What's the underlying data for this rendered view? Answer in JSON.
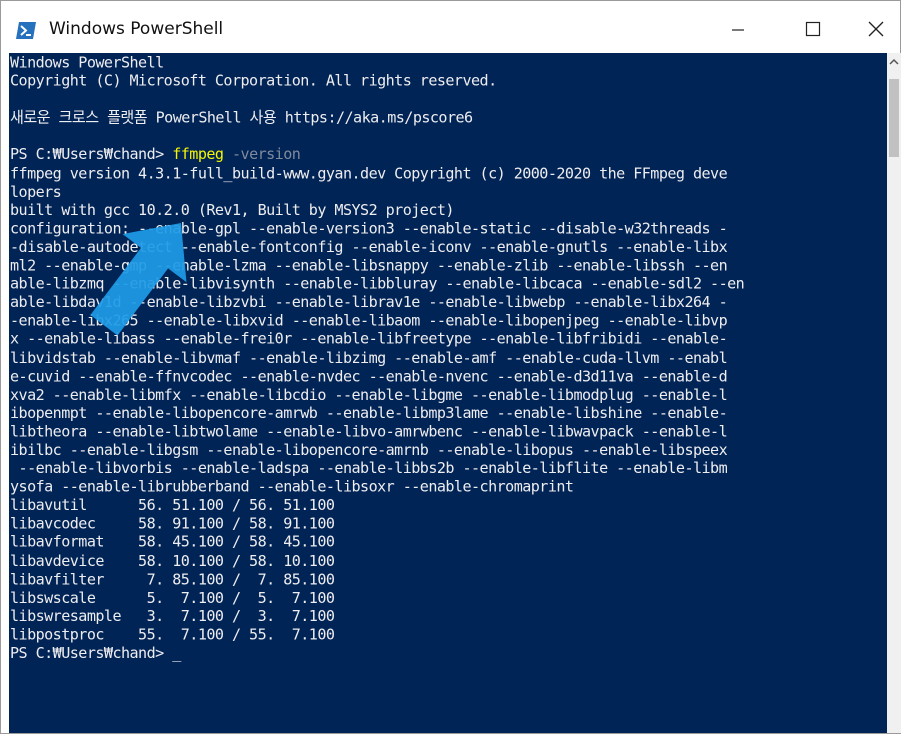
{
  "window": {
    "title": "Windows PowerShell",
    "icon": "powershell-icon",
    "controls": [
      "minimize-icon",
      "maximize-icon",
      "close-icon"
    ]
  },
  "console": {
    "lines": [
      "Windows PowerShell",
      "Copyright (C) Microsoft Corporation. All rights reserved.",
      "",
      "새로운 크로스 플랫폼 PowerShell 사용 https://aka.ms/pscore6",
      "",
      "",
      "ffmpeg version 4.3.1-full_build-www.gyan.dev Copyright (c) 2000-2020 the FFmpeg deve",
      "lopers",
      "built with gcc 10.2.0 (Rev1, Built by MSYS2 project)",
      "configuration: --enable-gpl --enable-version3 --enable-static --disable-w32threads -",
      "-disable-autodetect --enable-fontconfig --enable-iconv --enable-gnutls --enable-libx",
      "ml2 --enable-gmp --enable-lzma --enable-libsnappy --enable-zlib --enable-libssh --en",
      "able-libzmq --enable-libvisynth --enable-libbluray --enable-libcaca --enable-sdl2 --en",
      "able-libdav1d --enable-libzvbi --enable-librav1e --enable-libwebp --enable-libx264 -",
      "-enable-libx265 --enable-libxvid --enable-libaom --enable-libopenjpeg --enable-libvp",
      "x --enable-libass --enable-frei0r --enable-libfreetype --enable-libfribidi --enable-",
      "libvidstab --enable-libvmaf --enable-libzimg --enable-amf --enable-cuda-llvm --enabl",
      "e-cuvid --enable-ffnvcodec --enable-nvdec --enable-nvenc --enable-d3d11va --enable-d",
      "xva2 --enable-libmfx --enable-libcdio --enable-libgme --enable-libmodplug --enable-l",
      "ibopenmpt --enable-libopencore-amrwb --enable-libmp3lame --enable-libshine --enable-",
      "libtheora --enable-libtwolame --enable-libvo-amrwbenc --enable-libwavpack --enable-l",
      "ibilbc --enable-libgsm --enable-libopencore-amrnb --enable-libopus --enable-libspeex",
      " --enable-libvorbis --enable-ladspa --enable-libbs2b --enable-libflite --enable-libm",
      "ysofa --enable-librubberband --enable-libsoxr --enable-chromaprint",
      "libavutil      56. 51.100 / 56. 51.100",
      "libavcodec     58. 91.100 / 58. 91.100",
      "libavformat    58. 45.100 / 58. 45.100",
      "libavdevice    58. 10.100 / 58. 10.100",
      "libavfilter     7. 85.100 /  7. 85.100",
      "libswscale      5.  7.100 /  5.  7.100",
      "libswresample   3.  7.100 /  3.  7.100",
      "libpostproc    55.  7.100 / 55.  7.100"
    ],
    "prompt1": "PS C:₩Users₩chand> ",
    "command": "ffmpeg",
    "param": " -version",
    "prompt2": "PS C:₩Users₩chand> ",
    "cursor": "_"
  },
  "annotation": {
    "icon": "pointer-arrow-icon",
    "color": "#1e9be6"
  },
  "colors": {
    "console_bg": "#012456",
    "text": "#eeedf0",
    "command": "#f6f600",
    "param": "#7f8a9c"
  }
}
